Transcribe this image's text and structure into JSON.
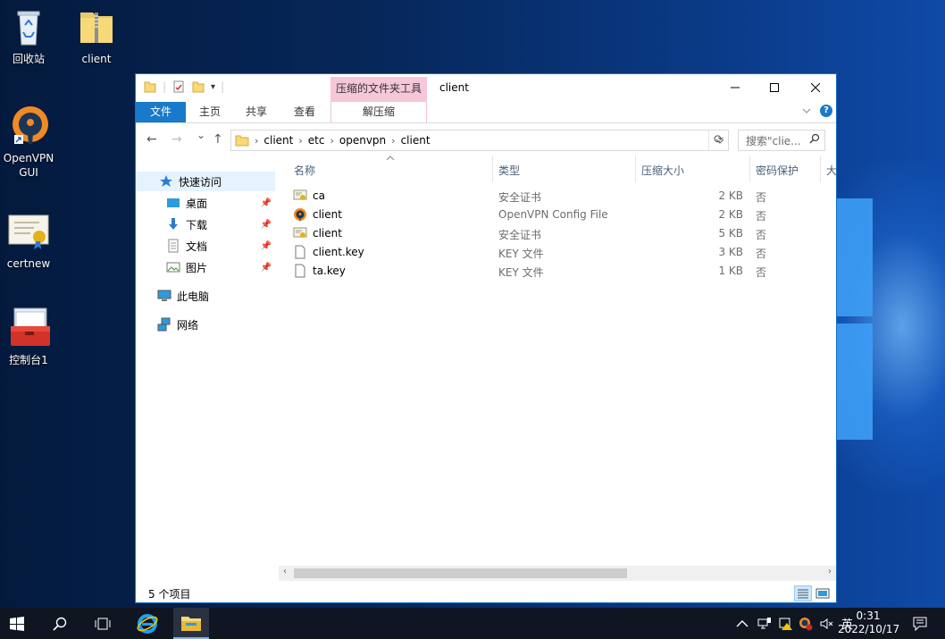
{
  "desktop": {
    "icons": [
      {
        "label": "回收站"
      },
      {
        "label": "client"
      },
      {
        "label": "OpenVPN GUI"
      },
      {
        "label": "certnew"
      },
      {
        "label": "控制台1"
      }
    ]
  },
  "window": {
    "title": "client",
    "context_tab_group": "压缩的文件夹工具",
    "ribbon_tabs": [
      "文件",
      "主页",
      "共享",
      "查看",
      "解压缩"
    ],
    "qat_dropdown_glyph": "▾"
  },
  "navbar": {
    "path": [
      "client",
      "etc",
      "openvpn",
      "client"
    ],
    "search_placeholder": "搜索\"clie...",
    "back_icon": "←",
    "forward_icon": "→",
    "up_icon": "↑",
    "recent_icon": "⌄",
    "refresh_icon": "⟳"
  },
  "nav_pane": {
    "quick_access": "快速访问",
    "pinned": [
      {
        "label": "桌面"
      },
      {
        "label": "下载"
      },
      {
        "label": "文档"
      },
      {
        "label": "图片"
      }
    ],
    "this_pc": "此电脑",
    "network": "网络"
  },
  "columns": {
    "name": "名称",
    "type": "类型",
    "compressed_size": "压缩大小",
    "password": "密码保护",
    "overflow": "大"
  },
  "files": [
    {
      "name": "ca",
      "type": "安全证书",
      "size": "2 KB",
      "protected": "否",
      "icon": "certificate-icon"
    },
    {
      "name": "client",
      "type": "OpenVPN Config File",
      "size": "2 KB",
      "protected": "否",
      "icon": "openvpn-config-icon"
    },
    {
      "name": "client",
      "type": "安全证书",
      "size": "5 KB",
      "protected": "否",
      "icon": "certificate-icon"
    },
    {
      "name": "client.key",
      "type": "KEY 文件",
      "size": "3 KB",
      "protected": "否",
      "icon": "file-icon"
    },
    {
      "name": "ta.key",
      "type": "KEY 文件",
      "size": "1 KB",
      "protected": "否",
      "icon": "file-icon"
    }
  ],
  "status": {
    "item_count": "5 个项目"
  },
  "taskbar": {
    "ime": "英",
    "time": "0:31",
    "date": "2022/10/17"
  },
  "colors": {
    "file_tab": "#1979ca",
    "context_tab": "#f5c7d9",
    "taskbar": "#101522",
    "selection": "#e5f3ff"
  }
}
